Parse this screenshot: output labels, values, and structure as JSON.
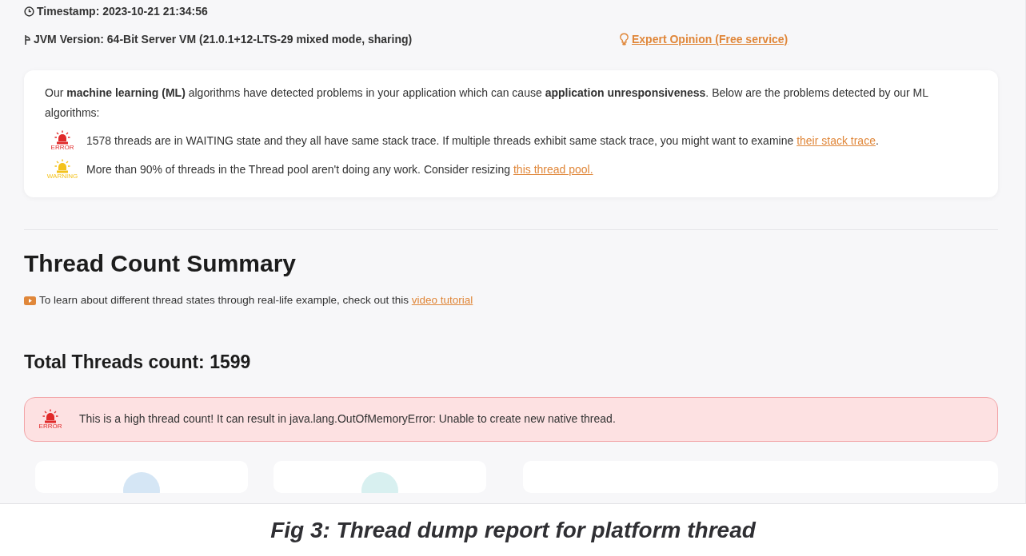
{
  "header": {
    "timestamp": "Timestamp: 2023-10-21 21:34:56",
    "jvm_version": "JVM Version: 64-Bit Server VM (21.0.1+12-LTS-29 mixed mode, sharing)",
    "expert_link": "Expert Opinion (Free service)"
  },
  "ml_panel": {
    "intro": "Our **machine learning (ML)** algorithms have detected problems in your application which can cause **application unresponsiveness**. Below are the problems detected by our ML algorithms:",
    "problems": [
      {
        "kind": "error",
        "badge": "ERROR",
        "text": "1578 threads are in WAITING state and they all have same stack trace. If multiple threads exhibit same stack trace, you might want to examine ",
        "link": "their stack trace",
        "after": "."
      },
      {
        "kind": "warning",
        "badge": "WARNING",
        "text": "More than 90% of threads in the Thread pool aren't doing any work. Consider resizing ",
        "link": "this thread pool."
      }
    ]
  },
  "summary": {
    "title": "Thread Count Summary",
    "tip": "To learn about different thread states through real-life example, check out this ",
    "tip_link": "video tutorial",
    "total": "Total Threads count: 1599",
    "alert": {
      "kind": "error",
      "badge": "ERROR",
      "text": "This is a high thread count! It can result in java.lang.OutOfMemoryError: Unable to create new native thread."
    }
  },
  "caption": "Fig 3: Thread dump report for platform thread"
}
